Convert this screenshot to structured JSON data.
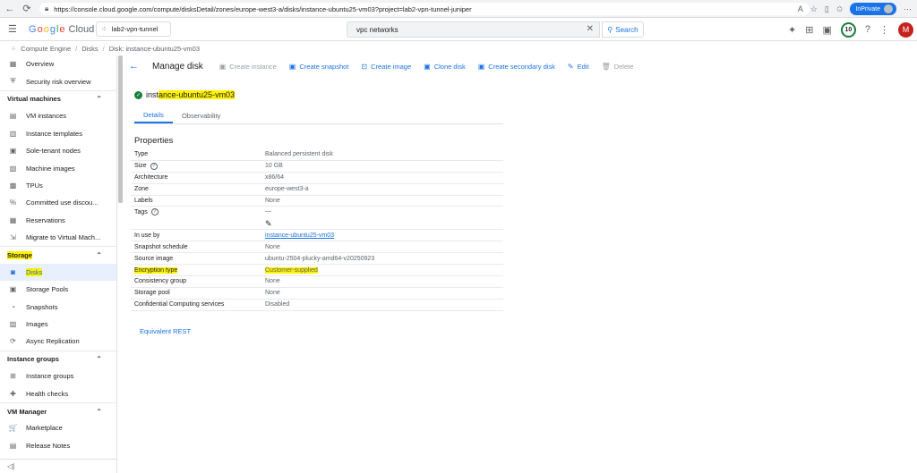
{
  "browser": {
    "url": "https://console.cloud.google.com/compute/disksDetail/zones/europe-west3-a/disks/instance-ubuntu25-vm03?project=lab2-vpn-tunnel-juniper",
    "inprivate_label": "InPrivate"
  },
  "header": {
    "logo_text": "Google Cloud",
    "project": "lab2-vpn-tunnel",
    "search_value": "vpc networks",
    "search_button": "Search",
    "notification_count": "10",
    "avatar_letter": "M"
  },
  "breadcrumb": [
    "Compute Engine",
    "Disks",
    "Disk: instance-ubuntu25-vm03"
  ],
  "sidebar": {
    "top_items": [
      {
        "label": "Overview",
        "icon": "overview-icon",
        "glyph": "▦"
      },
      {
        "label": "Security risk overview",
        "icon": "shield-icon",
        "glyph": "⛨"
      }
    ],
    "sections": [
      {
        "title": "Virtual machines",
        "items": [
          {
            "label": "VM instances",
            "glyph": "▤"
          },
          {
            "label": "Instance templates",
            "glyph": "▥"
          },
          {
            "label": "Sole-tenant nodes",
            "glyph": "▣"
          },
          {
            "label": "Machine images",
            "glyph": "▧"
          },
          {
            "label": "TPUs",
            "glyph": "▩"
          },
          {
            "label": "Committed use discou...",
            "glyph": "%"
          },
          {
            "label": "Reservations",
            "glyph": "▦"
          },
          {
            "label": "Migrate to Virtual Mach...",
            "glyph": "⇲"
          }
        ]
      },
      {
        "title": "Storage",
        "highlight": true,
        "items": [
          {
            "label": "Disks",
            "glyph": "◙",
            "active": true,
            "highlight": true
          },
          {
            "label": "Storage Pools",
            "glyph": "▣"
          },
          {
            "label": "Snapshots",
            "glyph": "◔"
          },
          {
            "label": "Images",
            "glyph": "▨"
          },
          {
            "label": "Async Replication",
            "glyph": "⟳"
          }
        ]
      },
      {
        "title": "Instance groups",
        "items": [
          {
            "label": "Instance groups",
            "glyph": "⊞"
          },
          {
            "label": "Health checks",
            "glyph": "✚"
          }
        ]
      },
      {
        "title": "VM Manager",
        "items": []
      }
    ],
    "bottom_items": [
      {
        "label": "Marketplace",
        "glyph": "🛒"
      },
      {
        "label": "Release Notes",
        "glyph": "▤"
      }
    ],
    "collapse_glyph": "◁|"
  },
  "toolbar": {
    "title": "Manage disk",
    "buttons": [
      {
        "label": "Create instance",
        "glyph": "▣",
        "disabled": true
      },
      {
        "label": "Create snapshot",
        "glyph": "▣",
        "disabled": false
      },
      {
        "label": "Create image",
        "glyph": "⊡",
        "disabled": false
      },
      {
        "label": "Clone disk",
        "glyph": "▣",
        "disabled": false
      },
      {
        "label": "Create secondary disk",
        "glyph": "▣",
        "disabled": false
      },
      {
        "label": "Edit",
        "glyph": "✎",
        "disabled": false
      },
      {
        "label": "Delete",
        "glyph": "🗑",
        "disabled": true
      }
    ]
  },
  "resource": {
    "name_prefix": "inst",
    "name_rest": "ance-ubuntu25-vm03",
    "tabs": [
      "Details",
      "Observability"
    ]
  },
  "properties": {
    "title": "Properties",
    "rows": [
      {
        "key": "Type",
        "value": "Balanced persistent disk"
      },
      {
        "key": "Size",
        "value": "10 GB",
        "help": true
      },
      {
        "key": "Architecture",
        "value": "x86/64"
      },
      {
        "key": "Zone",
        "value": "europe-west3-a"
      },
      {
        "key": "Labels",
        "value": "None"
      },
      {
        "key": "Tags",
        "value": "—",
        "help": true,
        "tall": true
      },
      {
        "key": "In use by",
        "value": "instance-ubuntu25-vm03",
        "link": true
      },
      {
        "key": "Snapshot schedule",
        "value": "None"
      },
      {
        "key": "Source image",
        "value": "ubuntu-2504-plucky-amd64-v20250923"
      },
      {
        "key": "Encryption type",
        "value": "Customer-supplied",
        "highlight": true
      },
      {
        "key": "Consistency group",
        "value": "None"
      },
      {
        "key": "Storage pool",
        "value": "None"
      },
      {
        "key": "Confidential Computing services",
        "value": "Disabled"
      }
    ]
  },
  "equivalent_rest": "Equivalent REST"
}
